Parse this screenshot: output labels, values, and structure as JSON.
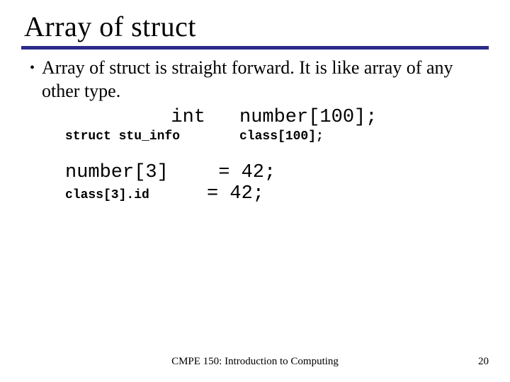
{
  "title": "Array of struct",
  "bullet": "Array of struct is straight forward. It is like array of any other type.",
  "code": {
    "decl1_type": "int",
    "decl1_rest": "number[100];",
    "decl2_type": "struct stu_info",
    "decl2_rest": "class[100];",
    "assign1_lhs": "number[3]",
    "assign1_rhs": "= 42;",
    "assign2_lhs": "class[3].id",
    "assign2_rhs": "= 42;"
  },
  "footer": "CMPE 150: Introduction to Computing",
  "page": "20"
}
